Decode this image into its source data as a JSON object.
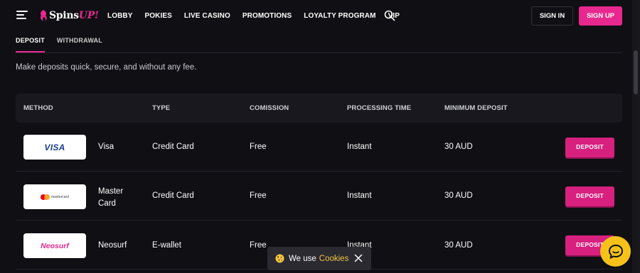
{
  "header": {
    "logo_text": "Spins",
    "logo_accent": "UP!",
    "nav": [
      "LOBBY",
      "POKIES",
      "LIVE CASINO",
      "PROMOTIONS",
      "LOYALTY PROGRAM",
      "VIP"
    ],
    "sign_in": "SIGN IN",
    "sign_up": "SIGN UP"
  },
  "tabs": {
    "deposit": "DEPOSIT",
    "withdrawal": "WITHDRAWAL"
  },
  "intro": "Make deposits quick, secure, and without any fee.",
  "table": {
    "headers": {
      "method": "METHOD",
      "type": "TYPE",
      "commission": "COMISSION",
      "processing": "PROCESSING TIME",
      "minimum": "MINIMUM DEPOSIT"
    },
    "rows": [
      {
        "logo": "VISA",
        "method_line1": "Visa",
        "method_line2": "",
        "type": "Credit Card",
        "commission": "Free",
        "processing": "Instant",
        "minimum": "30 AUD",
        "button": "DEPOSIT"
      },
      {
        "logo": "mastercard",
        "method_line1": "Master",
        "method_line2": "Card",
        "type": "Credit Card",
        "commission": "Free",
        "processing": "Instant",
        "minimum": "30 AUD",
        "button": "DEPOSIT"
      },
      {
        "logo": "Neosurf",
        "method_line1": "Neosurf",
        "method_line2": "",
        "type": "E-wallet",
        "commission": "Free",
        "processing": "Instant",
        "minimum": "30 AUD",
        "button": "DEPOSIT"
      }
    ]
  },
  "cookie": {
    "text": "We use",
    "link": "Cookies"
  },
  "icons": {
    "menu": "hamburger-icon",
    "search": "search-icon",
    "close": "close-icon",
    "cookie": "cookie-icon",
    "chat": "chat-icon"
  },
  "colors": {
    "accent": "#e8288e",
    "background": "#0f0f14",
    "chat": "#f6c21a",
    "cookie_link": "#f5c542"
  }
}
